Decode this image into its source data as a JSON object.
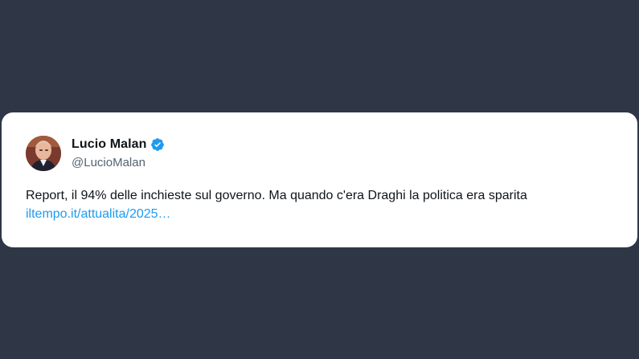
{
  "tweet": {
    "author_name": "Lucio Malan",
    "author_handle": "@LucioMalan",
    "verified_icon": "verified-badge-icon",
    "text": "Report, il 94% delle inchieste sul governo. Ma quando c'era Draghi la politica era sparita",
    "link_text": "iltempo.it/attualita/2025…"
  },
  "colors": {
    "background": "#2f3747",
    "card": "#ffffff",
    "link": "#1d9bf0",
    "verified": "#1d9bf0",
    "text": "#0f1419",
    "handle": "#536471"
  }
}
